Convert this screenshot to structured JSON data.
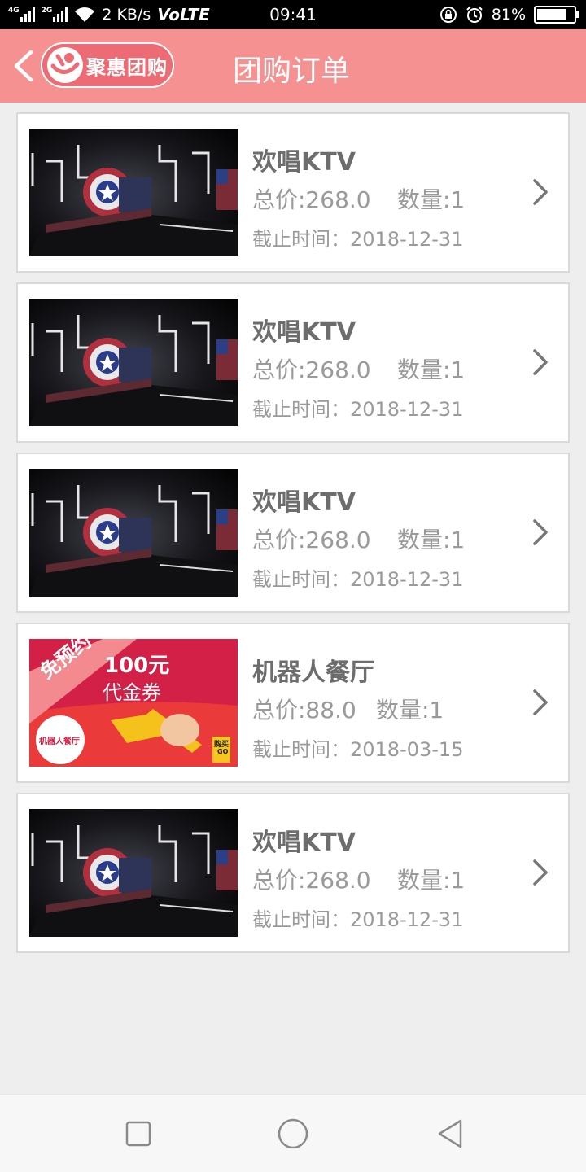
{
  "status_bar": {
    "net_top": "4G",
    "net_second": "2G",
    "speed": "2 KB/s",
    "volte": "VoLTE",
    "time": "09:41",
    "battery": "81%",
    "battery_level": 0.81
  },
  "header": {
    "brand": "聚惠团购",
    "title": "团购订单"
  },
  "orders": [
    {
      "name": "欢唱KTV",
      "price": "总价:268.0",
      "qty": "数量:1",
      "deadline": "截止时间：2018-12-31",
      "thumb": "ktv-room-photo"
    },
    {
      "name": "欢唱KTV",
      "price": "总价:268.0",
      "qty": "数量:1",
      "deadline": "截止时间：2018-12-31",
      "thumb": "ktv-room-photo"
    },
    {
      "name": "欢唱KTV",
      "price": "总价:268.0",
      "qty": "数量:1",
      "deadline": "截止时间：2018-12-31",
      "thumb": "ktv-room-photo"
    },
    {
      "name": "机器人餐厅",
      "price": "总价:88.0",
      "qty": "数量:1",
      "deadline": "截止时间：2018-03-15",
      "thumb": "voucher-banner"
    },
    {
      "name": "欢唱KTV",
      "price": "总价:268.0",
      "qty": "数量:1",
      "deadline": "截止时间：2018-12-31",
      "thumb": "ktv-room-photo"
    }
  ],
  "voucher": {
    "ribbon": "免预约",
    "amount": "100元",
    "label": "代金券",
    "shop": "机器人餐厅",
    "buy_line1": "购买",
    "buy_line2": "GO"
  },
  "colors": {
    "header_bg": "#f59191",
    "text_title": "#6d6d6d",
    "text_meta": "#9a9a9a",
    "voucher_red": "#d32046"
  }
}
